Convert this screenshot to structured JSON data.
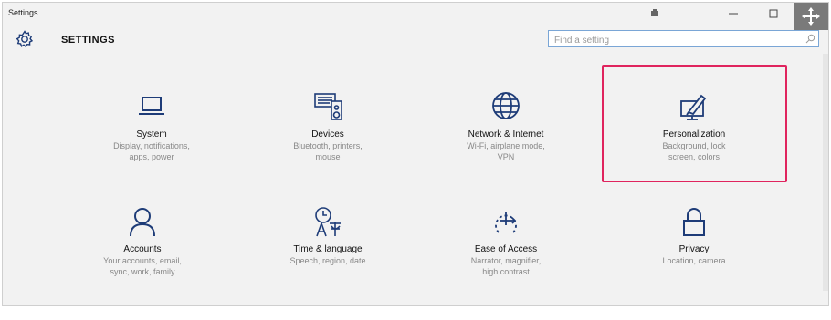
{
  "window": {
    "title": "Settings"
  },
  "header": {
    "title": "SETTINGS",
    "search_placeholder": "Find a setting"
  },
  "colors": {
    "highlight": "#e0245e",
    "icon": "#1e3c78",
    "search_border": "#7aa6d6"
  },
  "tiles": [
    {
      "title": "System",
      "desc": "Display, notifications,\napps, power",
      "icon": "laptop-icon"
    },
    {
      "title": "Devices",
      "desc": "Bluetooth, printers,\nmouse",
      "icon": "devices-icon"
    },
    {
      "title": "Network & Internet",
      "desc": "Wi-Fi, airplane mode,\nVPN",
      "icon": "globe-icon"
    },
    {
      "title": "Personalization",
      "desc": "Background, lock\nscreen, colors",
      "icon": "brush-monitor-icon"
    },
    {
      "title": "Accounts",
      "desc": "Your accounts, email,\nsync, work, family",
      "icon": "person-icon"
    },
    {
      "title": "Time & language",
      "desc": "Speech, region, date",
      "icon": "time-language-icon"
    },
    {
      "title": "Ease of Access",
      "desc": "Narrator, magnifier,\nhigh contrast",
      "icon": "ease-of-access-icon"
    },
    {
      "title": "Privacy",
      "desc": "Location, camera",
      "icon": "lock-icon"
    }
  ],
  "highlighted_tile": "Personalization"
}
